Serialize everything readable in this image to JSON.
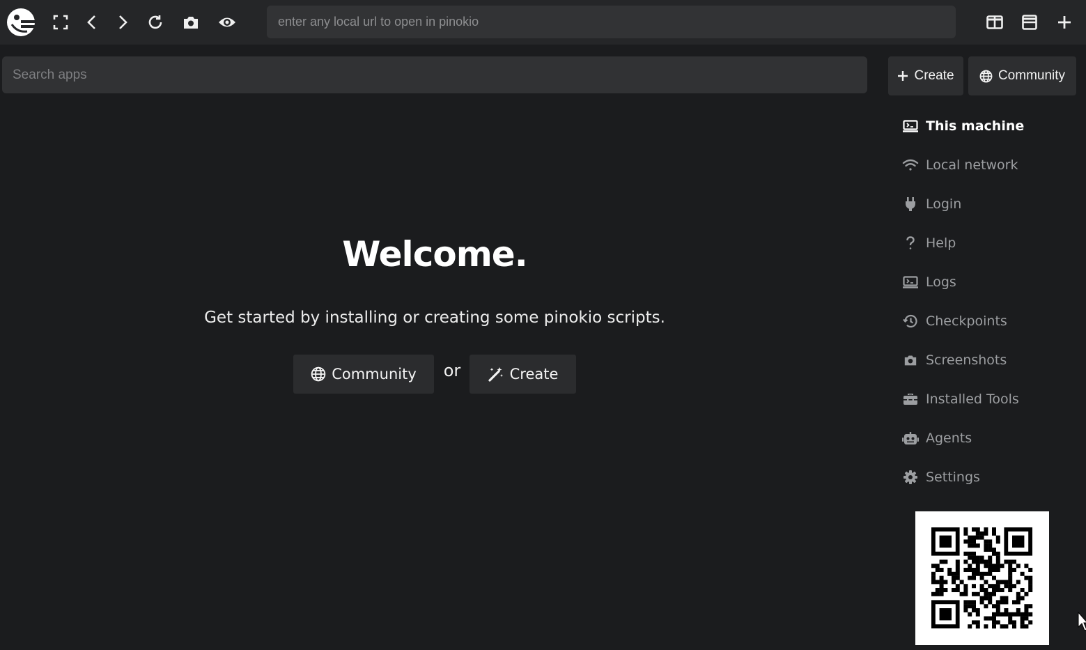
{
  "topbar": {
    "url_placeholder": "enter any local url to open in pinokio",
    "icons": [
      "pinokio-logo-icon",
      "fullscreen-icon",
      "back-icon",
      "forward-icon",
      "refresh-icon",
      "camera-icon",
      "eye-icon",
      "split-vertical-icon",
      "split-horizontal-icon",
      "plus-icon"
    ]
  },
  "search": {
    "placeholder": "Search apps"
  },
  "header_buttons": {
    "create": "Create",
    "community": "Community"
  },
  "welcome": {
    "title": "Welcome.",
    "subtitle": "Get started by installing or creating some pinokio scripts.",
    "community": "Community",
    "or": "or",
    "create": "Create"
  },
  "nav": {
    "items": [
      {
        "label": "This machine",
        "icon": "terminal-icon",
        "active": true
      },
      {
        "label": "Local network",
        "icon": "wifi-icon"
      },
      {
        "label": "Login",
        "icon": "plug-icon"
      },
      {
        "label": "Help",
        "icon": "question-icon"
      },
      {
        "label": "Logs",
        "icon": "terminal-icon"
      },
      {
        "label": "Checkpoints",
        "icon": "history-icon"
      },
      {
        "label": "Screenshots",
        "icon": "camera-icon"
      },
      {
        "label": "Installed Tools",
        "icon": "toolbox-icon"
      },
      {
        "label": "Agents",
        "icon": "robot-icon"
      },
      {
        "label": "Settings",
        "icon": "gear-icon"
      }
    ]
  },
  "colors": {
    "background": "#1b1c1e",
    "topbar": "#252628",
    "nav_inactive": "#9c9ea1",
    "nav_active": "#ffffff"
  }
}
